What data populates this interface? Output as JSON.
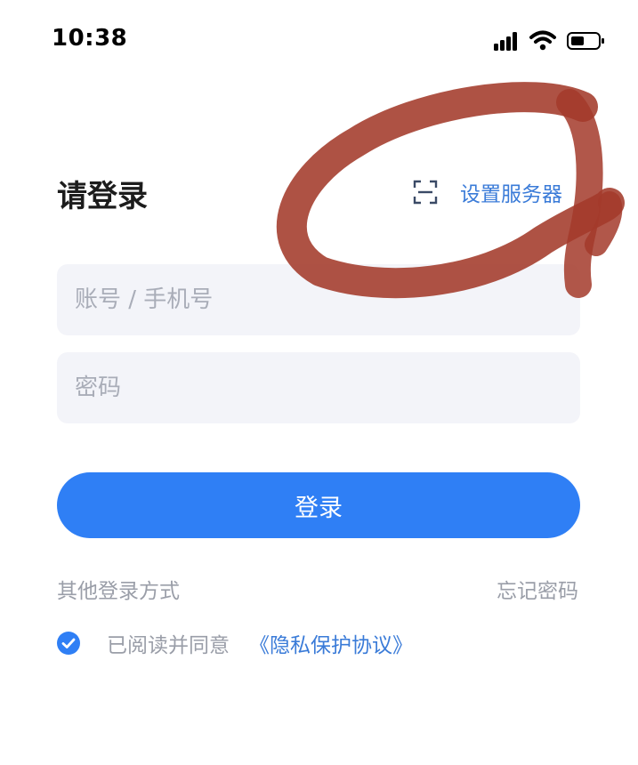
{
  "status_bar": {
    "time": "10:38",
    "icons": [
      "signal-icon",
      "wifi-icon",
      "battery-icon"
    ]
  },
  "header": {
    "title": "请登录",
    "server_link": {
      "icon": "scan-icon",
      "label": "设置服务器"
    }
  },
  "form": {
    "account": {
      "value": "",
      "placeholder": "账号 / 手机号"
    },
    "password": {
      "value": "",
      "placeholder": "密码"
    },
    "login_label": "登录"
  },
  "links": {
    "other_login": "其他登录方式",
    "forgot_password": "忘记密码"
  },
  "agreement": {
    "checked": true,
    "text": "已阅读并同意",
    "link": "《隐私保护协议》"
  },
  "colors": {
    "accent": "#2f7ff5",
    "link": "#3a7bd8",
    "input_bg": "#f3f4f9",
    "muted_text": "#9a9ea8",
    "annotation": "#a33a2a"
  }
}
